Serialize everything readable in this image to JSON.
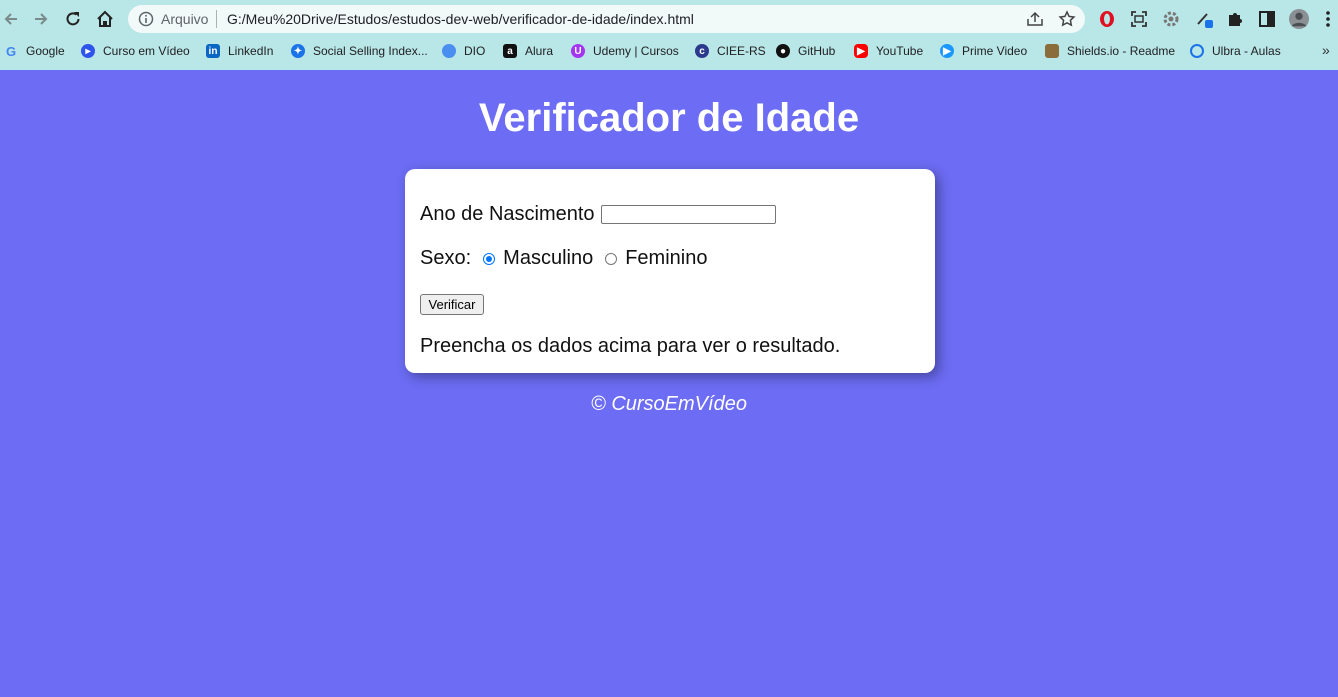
{
  "browser": {
    "url_scheme_label": "Arquivo",
    "url": "G:/Meu%20Drive/Estudos/estudos-dev-web/verificador-de-idade/index.html",
    "bookmarks": [
      {
        "label": "Google",
        "icon": "google-icon",
        "color": "#4285f4"
      },
      {
        "label": "Curso em Vídeo",
        "icon": "cursoemvideo-icon",
        "color": "#2f54eb"
      },
      {
        "label": "LinkedIn",
        "icon": "linkedin-icon",
        "color": "#0a66c2"
      },
      {
        "label": "Social Selling Index...",
        "icon": "compass-icon",
        "color": "#1a73e8"
      },
      {
        "label": "DIO",
        "icon": "dio-icon",
        "color": "#4a8ef0"
      },
      {
        "label": "Alura",
        "icon": "alura-icon",
        "color": "#111111"
      },
      {
        "label": "Udemy | Cursos",
        "icon": "udemy-icon",
        "color": "#a435f0"
      },
      {
        "label": "CIEE-RS",
        "icon": "ciee-icon",
        "color": "#2b3a8c"
      },
      {
        "label": "GitHub",
        "icon": "github-icon",
        "color": "#111111"
      },
      {
        "label": "YouTube",
        "icon": "youtube-icon",
        "color": "#ff0000"
      },
      {
        "label": "Prime Video",
        "icon": "primevideo-icon",
        "color": "#1a98ff"
      },
      {
        "label": "Shields.io - Readme",
        "icon": "shields-icon",
        "color": "#8a6d3b"
      },
      {
        "label": "Ulbra - Aulas",
        "icon": "ulbra-icon",
        "color": "#1a73e8"
      }
    ],
    "more_label": "»"
  },
  "page": {
    "title": "Verificador de Idade",
    "year_label": "Ano de Nascimento",
    "year_value": "",
    "sex_label": "Sexo:",
    "option_male": "Masculino",
    "option_female": "Feminino",
    "selected_option": "Masculino",
    "verify_button": "Verificar",
    "result": "Preencha os dados acima para ver o resultado.",
    "footer": "© CursoEmVídeo"
  },
  "colors": {
    "page_background": "#6c6cf4",
    "card_background": "#ffffff",
    "chrome_background": "#b9e6e6",
    "radio_accent": "#0075ff"
  }
}
